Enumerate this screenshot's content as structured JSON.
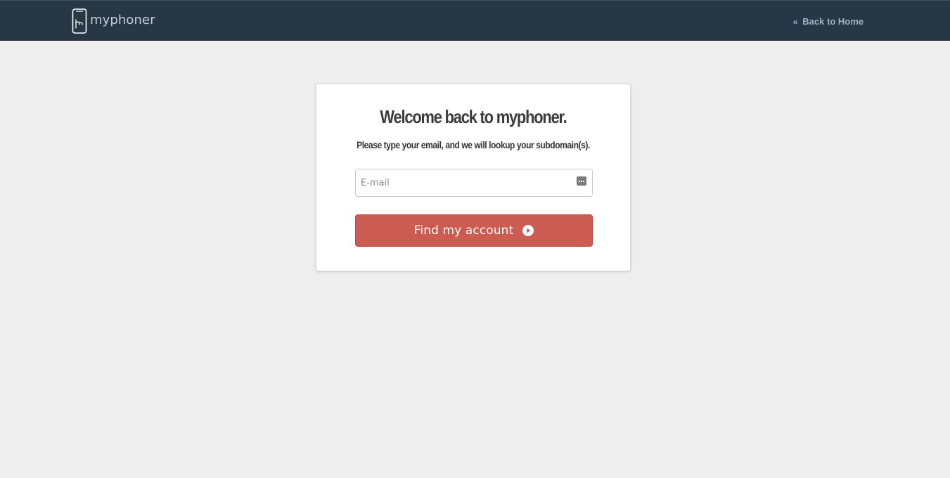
{
  "header": {
    "logo_text": "myphoner",
    "back_link_label": "Back to Home",
    "back_icon": "double-chevron-left-icon"
  },
  "card": {
    "title": "Welcome back to myphoner.",
    "subtitle": "Please type your email, and we will lookup your subdomain(s).",
    "email": {
      "placeholder": "E-mail",
      "value": ""
    },
    "submit_label": "Find my account",
    "submit_icon": "play-circle-icon"
  },
  "colors": {
    "header_bg": "#283745",
    "page_bg": "#eeeeee",
    "button_bg": "#cc5b52",
    "logo_text": "#c4cfda",
    "back_link": "#9fb2c6"
  }
}
